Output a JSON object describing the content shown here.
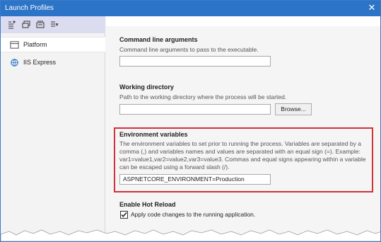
{
  "window": {
    "title": "Launch Profiles"
  },
  "sidebar": {
    "toolbar_icons": [
      "new-profile-icon",
      "copy-profile-icon",
      "rename-profile-icon",
      "delete-profile-icon"
    ],
    "items": [
      {
        "label": "Platform",
        "icon": "platform-icon",
        "selected": true
      },
      {
        "label": "IIS Express",
        "icon": "iis-express-icon",
        "selected": false
      }
    ]
  },
  "cmd": {
    "title": "Command line arguments",
    "desc": "Command line arguments to pass to the executable.",
    "value": ""
  },
  "wd": {
    "title": "Working directory",
    "desc": "Path to the working directory where the process will be started.",
    "value": "",
    "browse_label": "Browse..."
  },
  "env": {
    "title": "Environment variables",
    "desc_lines": [
      "The environment variables to set prior to running the process. Variables are separated by a",
      "comma (,) and variables names and values are separated with an equal sign (=). Example:",
      "var1=value1,var2=value2,var3=value3. Commas and equal signs appearing within a variable",
      "can be escaped using a forward slash (/)."
    ],
    "value": "ASPNETCORE_ENVIRONMENT=Production"
  },
  "hot": {
    "title": "Enable Hot Reload",
    "checkbox_label": "Apply code changes to the running application.",
    "checked": true
  },
  "colors": {
    "titlebar": "#2b74c7",
    "highlight_border": "#d1323a",
    "toolbar": "#dcdcf0"
  }
}
